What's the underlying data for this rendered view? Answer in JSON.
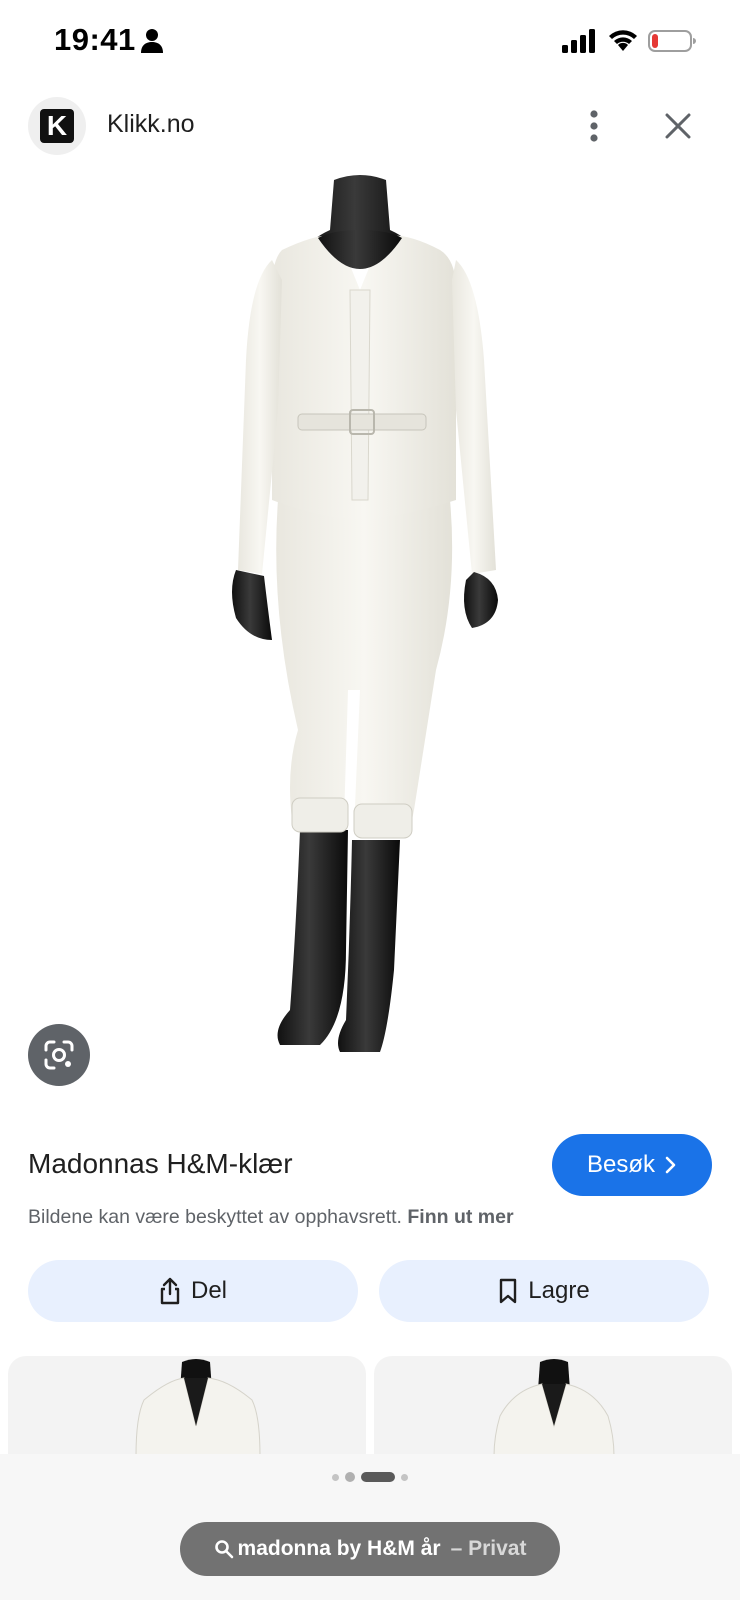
{
  "status_bar": {
    "time": "19:41",
    "icons": [
      "person-icon",
      "signal-icon",
      "wifi-icon",
      "battery-low-icon"
    ],
    "battery_color": "#e53935"
  },
  "header": {
    "site_logo_letter": "K",
    "site_name": "Klikk.no",
    "icons": [
      "more-vert-icon",
      "close-icon"
    ]
  },
  "main_image": {
    "icon": "google-lens-icon"
  },
  "result": {
    "title": "Madonnas H&M-klær",
    "visit_label": "Besøk",
    "copyright_text": "Bildene kan være beskyttet av opphavsrett.",
    "copyright_link": "Finn ut mer",
    "share_label": "Del",
    "save_label": "Lagre",
    "accent": "#1a73e8",
    "action_bg": "#e8f0fe"
  },
  "search": {
    "query": "madonna by H&M år",
    "mode": "– Privat"
  },
  "pagination": {
    "count": 4,
    "active_index": 2
  }
}
